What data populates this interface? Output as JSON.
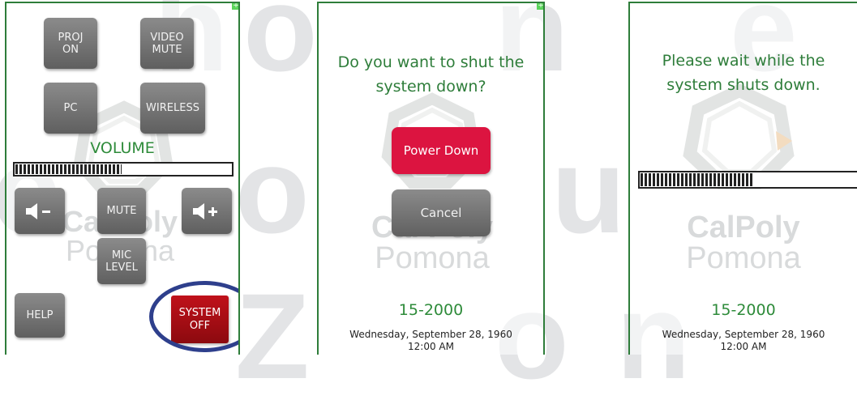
{
  "background": {
    "watermark_letters": [
      "h",
      "o",
      "n",
      "e",
      "c",
      "o",
      "u",
      "Z",
      "o",
      "n"
    ],
    "colors": {
      "panel_border": "#2e7d3a",
      "accent_green": "#2e8b3a",
      "danger_red": "#dc1440",
      "system_off_red": "#b0101a",
      "ring_blue": "#2e3f8c"
    }
  },
  "panels": {
    "main": {
      "buttons": {
        "proj_on": "PROJ\nON",
        "video_mute": "VIDEO\nMUTE",
        "pc": "PC",
        "wireless": "WIRELESS",
        "vol_down_icon": "speaker-minus-icon",
        "mute": "MUTE",
        "vol_up_icon": "speaker-plus-icon",
        "mic_level": "MIC\nLEVEL",
        "help": "HELP",
        "system_off": "SYSTEM\nOFF"
      },
      "volume_label": "VOLUME",
      "volume_level": 0.49,
      "watermark": {
        "line1": "Cal Poly",
        "line2": "Pomona"
      }
    },
    "confirm": {
      "question_line1": "Do you want to shut the",
      "question_line2": "system down?",
      "power_down_label": "Power Down",
      "cancel_label": "Cancel",
      "watermark": {
        "line1": "Cal Poly",
        "line2": "Pomona"
      },
      "room": "15-2000",
      "date": "Wednesday, September 28, 1960",
      "time": "12:00 AM"
    },
    "shutdown": {
      "message_line1": "Please wait while the",
      "message_line2": "system shuts down.",
      "progress": 0.52,
      "watermark": {
        "line1": "CalPoly",
        "line2": "Pomona"
      },
      "room": "15-2000",
      "date": "Wednesday, September 28, 1960",
      "time": "12:00 AM"
    }
  }
}
